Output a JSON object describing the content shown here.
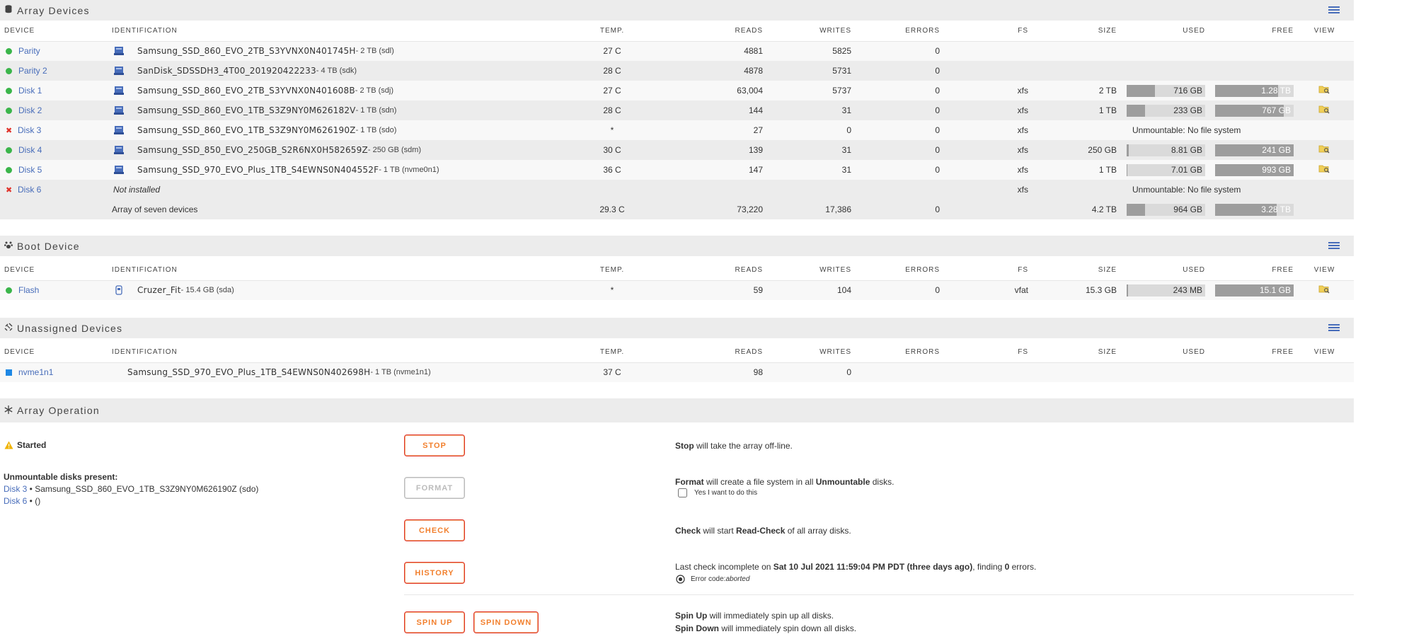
{
  "array_devices": {
    "title": "Array Devices",
    "columns": [
      "DEVICE",
      "IDENTIFICATION",
      "TEMP.",
      "READS",
      "WRITES",
      "ERRORS",
      "FS",
      "SIZE",
      "USED",
      "FREE",
      "VIEW"
    ],
    "rows": [
      {
        "status": "green",
        "device": "Parity",
        "id": "Samsung_SSD_860_EVO_2TB_S3YVNX0N401745H",
        "id_suffix": " - 2 TB (sdl)",
        "temp": "27 C",
        "reads": "4881",
        "writes": "5825",
        "errors": "0",
        "fs": "",
        "size": "",
        "used": "",
        "used_pct": 0,
        "free": "",
        "free_pct": 0,
        "view": false
      },
      {
        "status": "green",
        "device": "Parity 2",
        "id": "SanDisk_SDSSDH3_4T00_201920422233",
        "id_suffix": " - 4 TB (sdk)",
        "temp": "28 C",
        "reads": "4878",
        "writes": "5731",
        "errors": "0",
        "fs": "",
        "size": "",
        "used": "",
        "used_pct": 0,
        "free": "",
        "free_pct": 0,
        "view": false
      },
      {
        "status": "green",
        "device": "Disk 1",
        "id": "Samsung_SSD_860_EVO_2TB_S3YVNX0N401608B",
        "id_suffix": " - 2 TB (sdj)",
        "temp": "27 C",
        "reads": "63,004",
        "writes": "5737",
        "errors": "0",
        "fs": "xfs",
        "size": "2 TB",
        "used": "716 GB",
        "used_pct": 36,
        "free": "1.28 TB",
        "free_pct": 80,
        "view": true
      },
      {
        "status": "green",
        "device": "Disk 2",
        "id": "Samsung_SSD_860_EVO_1TB_S3Z9NY0M626182V",
        "id_suffix": " - 1 TB (sdn)",
        "temp": "28 C",
        "reads": "144",
        "writes": "31",
        "errors": "0",
        "fs": "xfs",
        "size": "1 TB",
        "used": "233 GB",
        "used_pct": 23,
        "free": "767 GB",
        "free_pct": 87,
        "view": true
      },
      {
        "status": "red",
        "device": "Disk 3",
        "id": "Samsung_SSD_860_EVO_1TB_S3Z9NY0M626190Z",
        "id_suffix": " - 1 TB (sdo)",
        "temp": "*",
        "reads": "27",
        "writes": "0",
        "errors": "0",
        "fs": "xfs",
        "size": "",
        "unmountable": "Unmountable: No file system",
        "view": false
      },
      {
        "status": "green",
        "device": "Disk 4",
        "id": "Samsung_SSD_850_EVO_250GB_S2R6NX0H582659Z",
        "id_suffix": " - 250 GB (sdm)",
        "temp": "30 C",
        "reads": "139",
        "writes": "31",
        "errors": "0",
        "fs": "xfs",
        "size": "250 GB",
        "used": "8.81 GB",
        "used_pct": 3,
        "free": "241 GB",
        "free_pct": 100,
        "view": true
      },
      {
        "status": "green",
        "device": "Disk 5",
        "id": "Samsung_SSD_970_EVO_Plus_1TB_S4EWNS0N404552F",
        "id_suffix": " - 1 TB (nvme0n1)",
        "temp": "36 C",
        "reads": "147",
        "writes": "31",
        "errors": "0",
        "fs": "xfs",
        "size": "1 TB",
        "used": "7.01 GB",
        "used_pct": 1,
        "free": "993 GB",
        "free_pct": 100,
        "view": true
      },
      {
        "status": "red",
        "device": "Disk 6",
        "id": "Not installed",
        "id_suffix": "",
        "id_italic": true,
        "temp": "",
        "reads": "",
        "writes": "",
        "errors": "",
        "fs": "xfs",
        "size": "",
        "unmountable": "Unmountable: No file system",
        "view": false
      }
    ],
    "summary": {
      "label": "Array of seven devices",
      "temp": "29.3 C",
      "reads": "73,220",
      "writes": "17,386",
      "errors": "0",
      "size": "4.2 TB",
      "used": "964 GB",
      "used_pct": 23,
      "free": "3.28 TB",
      "free_pct": 78
    }
  },
  "boot_device": {
    "title": "Boot Device",
    "columns": [
      "DEVICE",
      "IDENTIFICATION",
      "TEMP.",
      "READS",
      "WRITES",
      "ERRORS",
      "FS",
      "SIZE",
      "USED",
      "FREE",
      "VIEW"
    ],
    "row": {
      "device": "Flash",
      "id": "Cruzer_Fit",
      "id_suffix": " - 15.4 GB (sda)",
      "temp": "*",
      "reads": "59",
      "writes": "104",
      "errors": "0",
      "fs": "vfat",
      "size": "15.3 GB",
      "used": "243 MB",
      "used_pct": 2,
      "free": "15.1 GB",
      "free_pct": 100
    }
  },
  "unassigned_devices": {
    "title": "Unassigned Devices",
    "columns": [
      "DEVICE",
      "IDENTIFICATION",
      "TEMP.",
      "READS",
      "WRITES",
      "ERRORS",
      "FS",
      "SIZE",
      "USED",
      "FREE",
      "VIEW"
    ],
    "row": {
      "device": "nvme1n1",
      "id": "Samsung_SSD_970_EVO_Plus_1TB_S4EWNS0N402698H",
      "id_suffix": " - 1 TB (nvme1n1)",
      "temp": "37 C",
      "reads": "98",
      "writes": "0"
    }
  },
  "array_operation": {
    "title": "Array Operation",
    "status": "Started",
    "unmountable_heading": "Unmountable disks present:",
    "unmountable_lines": [
      {
        "disk": "Disk 3",
        "rest": " • Samsung_SSD_860_EVO_1TB_S3Z9NY0M626190Z (sdo)"
      },
      {
        "disk": "Disk 6",
        "rest": " • ()"
      }
    ],
    "buttons": {
      "stop": "STOP",
      "format": "FORMAT",
      "check": "CHECK",
      "history": "HISTORY",
      "spin_up": "SPIN UP",
      "spin_down": "SPIN DOWN"
    },
    "stop_desc": {
      "b": "Stop",
      "rest": " will take the array off-line."
    },
    "format_desc": {
      "b1": "Format",
      "mid": " will create a file system in all ",
      "b2": "Unmountable",
      "end": " disks."
    },
    "format_confirm": "Yes I want to do this",
    "check_desc": {
      "b1": "Check",
      "mid": " will start ",
      "b2": "Read-Check",
      "end": " of all array disks."
    },
    "history_desc": {
      "pre": "Last check incomplete on ",
      "b1": "Sat 10 Jul 2021 11:59:04 PM PDT (three days ago)",
      "mid": ", finding ",
      "b2": "0",
      "end": " errors."
    },
    "error_code_label": "Error code: ",
    "error_code": "aborted",
    "spinup_desc": {
      "b": "Spin Up",
      "rest": " will immediately spin up all disks."
    },
    "spindown_desc": {
      "b": "Spin Down",
      "rest": " will immediately spin down all disks."
    }
  },
  "colors": {
    "accent": "#486dba",
    "status_ok": "#3ab54a",
    "status_err": "#e0332b",
    "button_text": "#f2802e",
    "warning": "#f0b400",
    "bar_used": "#9d9d9d",
    "bar_bg": "#dadada"
  }
}
